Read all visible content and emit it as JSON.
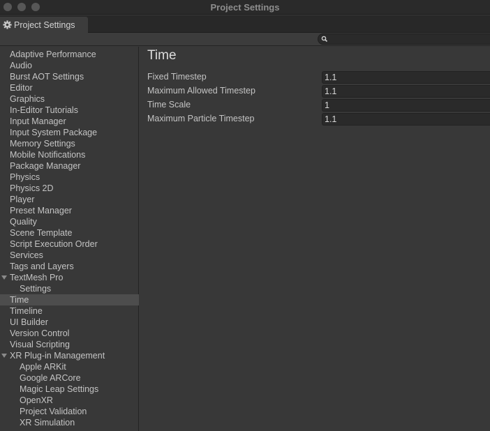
{
  "window": {
    "title": "Project Settings"
  },
  "tab": {
    "label": "Project Settings",
    "icon": "gear-icon"
  },
  "search": {
    "value": "",
    "placeholder": ""
  },
  "sidebar": {
    "items": [
      {
        "label": "Adaptive Performance",
        "level": 0
      },
      {
        "label": "Audio",
        "level": 0
      },
      {
        "label": "Burst AOT Settings",
        "level": 0
      },
      {
        "label": "Editor",
        "level": 0
      },
      {
        "label": "Graphics",
        "level": 0
      },
      {
        "label": "In-Editor Tutorials",
        "level": 0
      },
      {
        "label": "Input Manager",
        "level": 0
      },
      {
        "label": "Input System Package",
        "level": 0
      },
      {
        "label": "Memory Settings",
        "level": 0
      },
      {
        "label": "Mobile Notifications",
        "level": 0
      },
      {
        "label": "Package Manager",
        "level": 0
      },
      {
        "label": "Physics",
        "level": 0
      },
      {
        "label": "Physics 2D",
        "level": 0
      },
      {
        "label": "Player",
        "level": 0
      },
      {
        "label": "Preset Manager",
        "level": 0
      },
      {
        "label": "Quality",
        "level": 0
      },
      {
        "label": "Scene Template",
        "level": 0
      },
      {
        "label": "Script Execution Order",
        "level": 0
      },
      {
        "label": "Services",
        "level": 0
      },
      {
        "label": "Tags and Layers",
        "level": 0
      },
      {
        "label": "TextMesh Pro",
        "level": 0,
        "expanded": true
      },
      {
        "label": "Settings",
        "level": 1
      },
      {
        "label": "Time",
        "level": 0,
        "selected": true
      },
      {
        "label": "Timeline",
        "level": 0
      },
      {
        "label": "UI Builder",
        "level": 0
      },
      {
        "label": "Version Control",
        "level": 0
      },
      {
        "label": "Visual Scripting",
        "level": 0
      },
      {
        "label": "XR Plug-in Management",
        "level": 0,
        "expanded": true
      },
      {
        "label": "Apple ARKit",
        "level": 1
      },
      {
        "label": "Google ARCore",
        "level": 1
      },
      {
        "label": "Magic Leap Settings",
        "level": 1
      },
      {
        "label": "OpenXR",
        "level": 1
      },
      {
        "label": "Project Validation",
        "level": 1
      },
      {
        "label": "XR Simulation",
        "level": 1
      }
    ]
  },
  "main": {
    "title": "Time",
    "properties": [
      {
        "label": "Fixed Timestep",
        "value": "1.1"
      },
      {
        "label": "Maximum Allowed Timestep",
        "value": "1.1"
      },
      {
        "label": "Time Scale",
        "value": "1"
      },
      {
        "label": "Maximum Particle Timestep",
        "value": "1.1"
      }
    ]
  },
  "colors": {
    "background": "#383838",
    "selected_row": "#4d4d4d",
    "field_background": "#2a2a2a",
    "text": "#c4c4c4"
  }
}
